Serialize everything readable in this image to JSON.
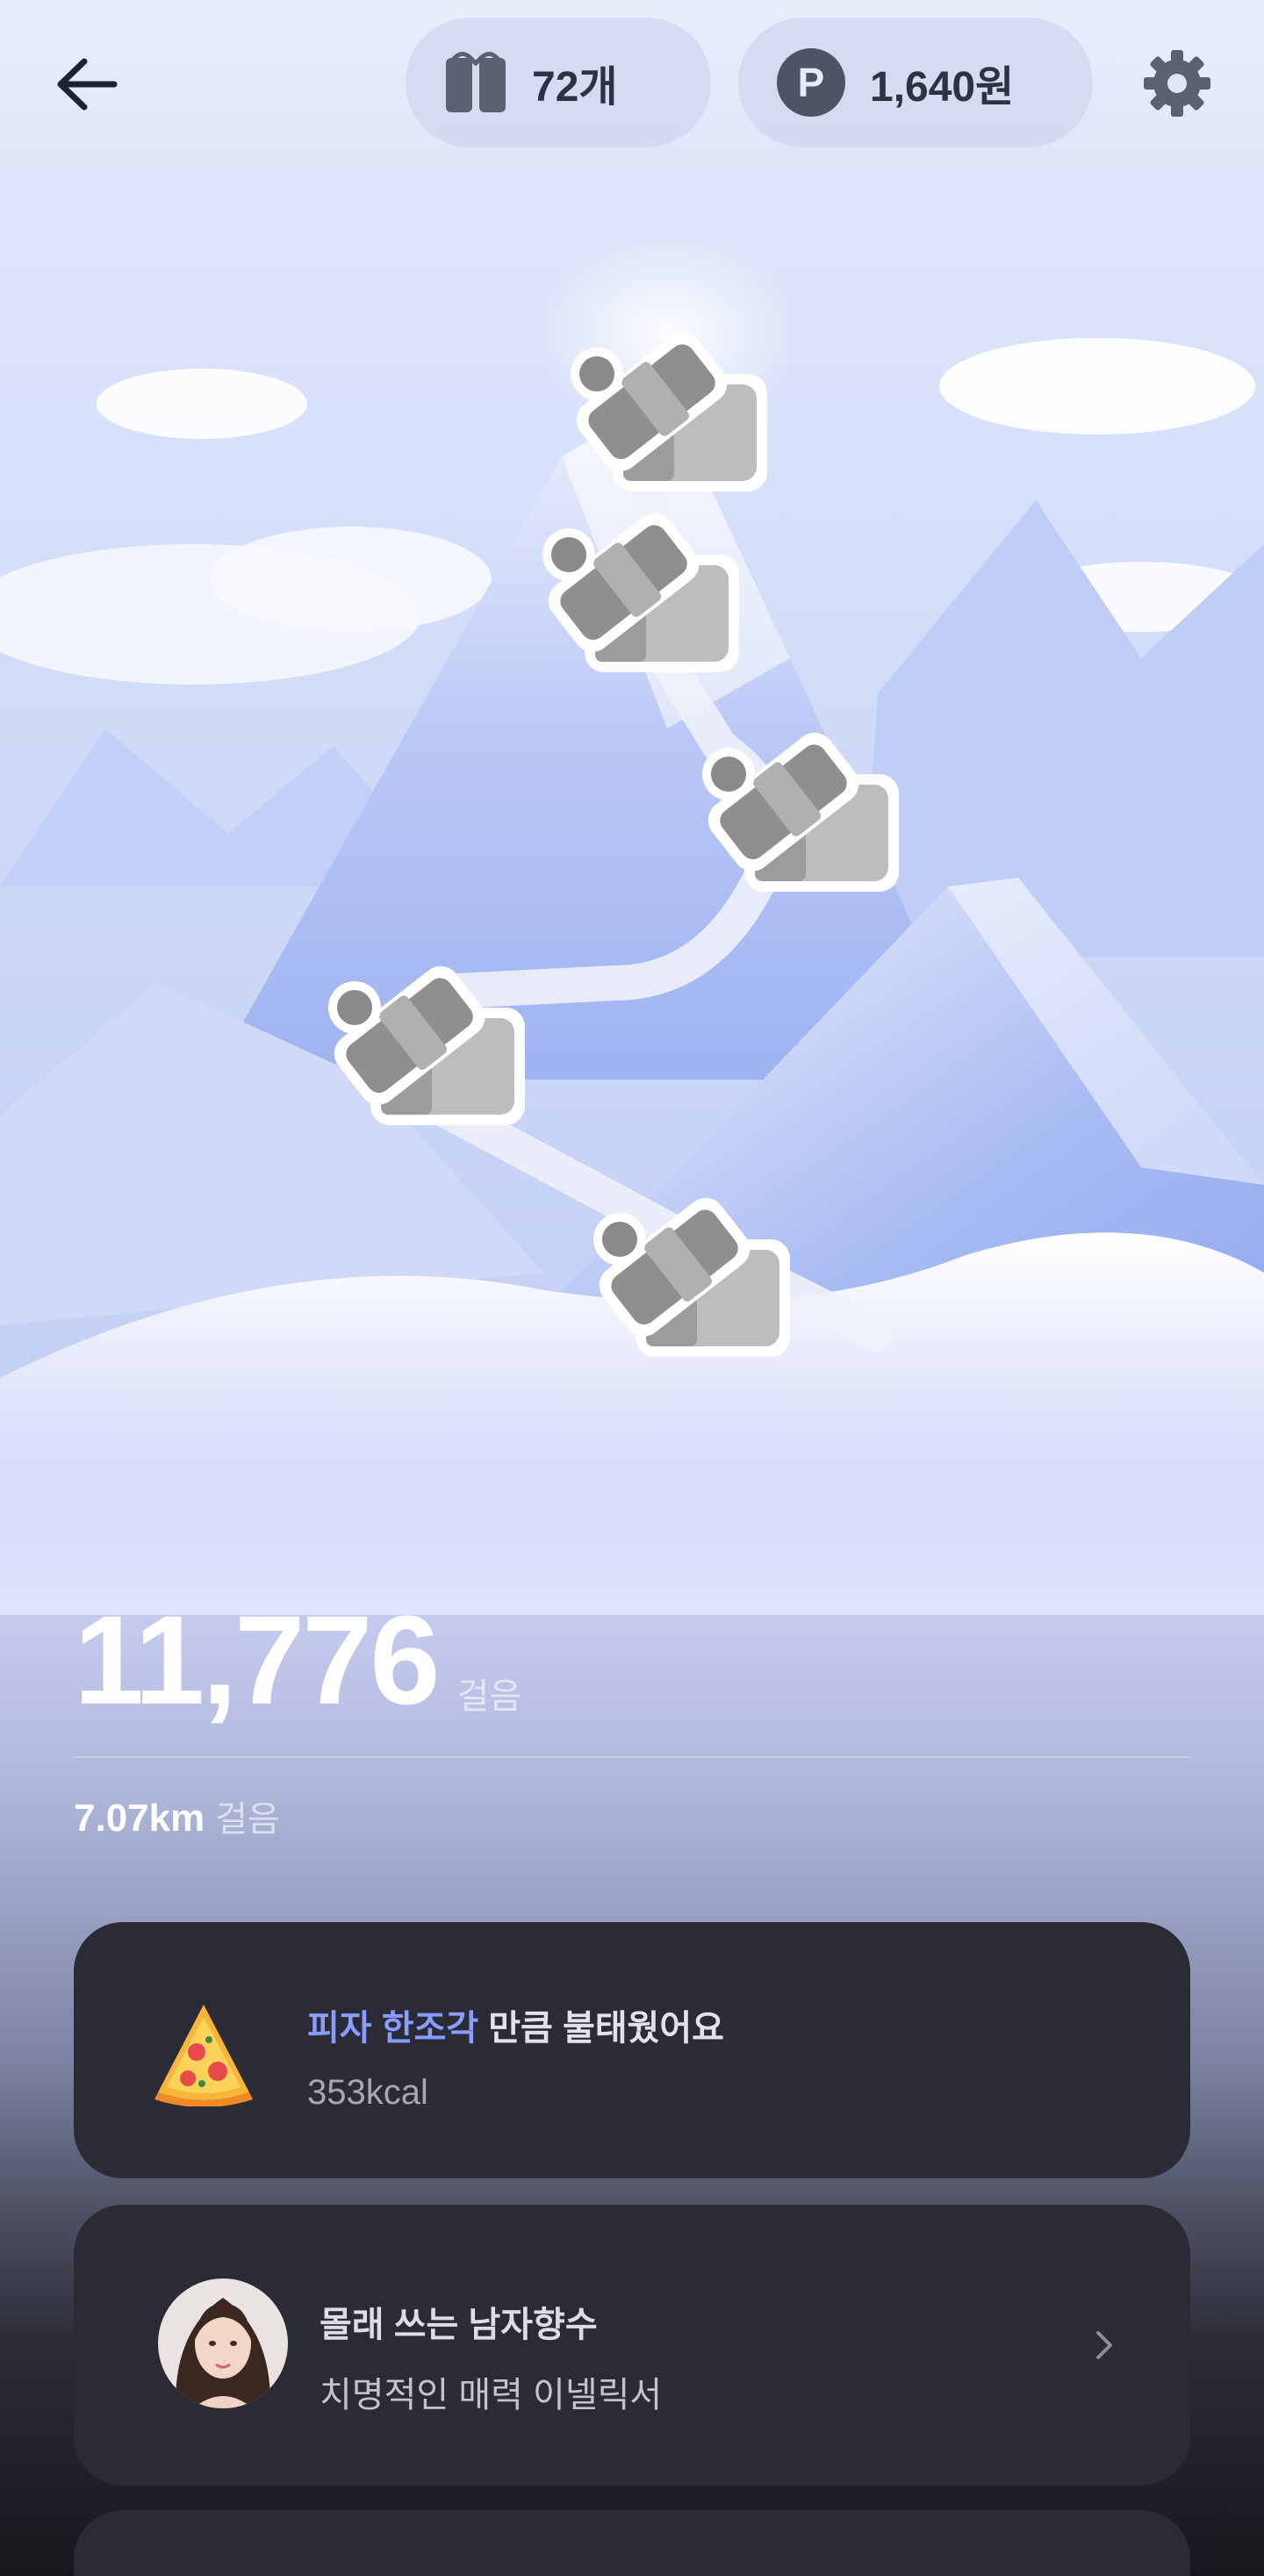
{
  "header": {
    "back_icon": "arrow-left-icon",
    "tickets": {
      "icon": "gift-icon",
      "label": "72개"
    },
    "points": {
      "badge": "P",
      "label": "1,640원"
    },
    "settings_icon": "gear-icon"
  },
  "scene": {
    "gift_boxes": 5,
    "colors": {
      "sky": "#dfe7fb",
      "mountain": "#b7c6f6",
      "path": "#f2f4fb",
      "gift": "#a9a9a9"
    }
  },
  "stats": {
    "steps": "11,776",
    "steps_unit": "걸음",
    "distance": "7.07km",
    "distance_unit": "걸음"
  },
  "calorie_card": {
    "icon": "pizza-icon",
    "highlight": "피자 한조각",
    "title_rest": " 만큼 불태웠어요",
    "subtitle": "353kcal",
    "highlight_color": "#8a9dff"
  },
  "ad_card": {
    "title": "몰래 쓰는 남자향수",
    "subtitle": "치명적인 매력 이넬릭서",
    "chevron_icon": "chevron-right-icon"
  }
}
